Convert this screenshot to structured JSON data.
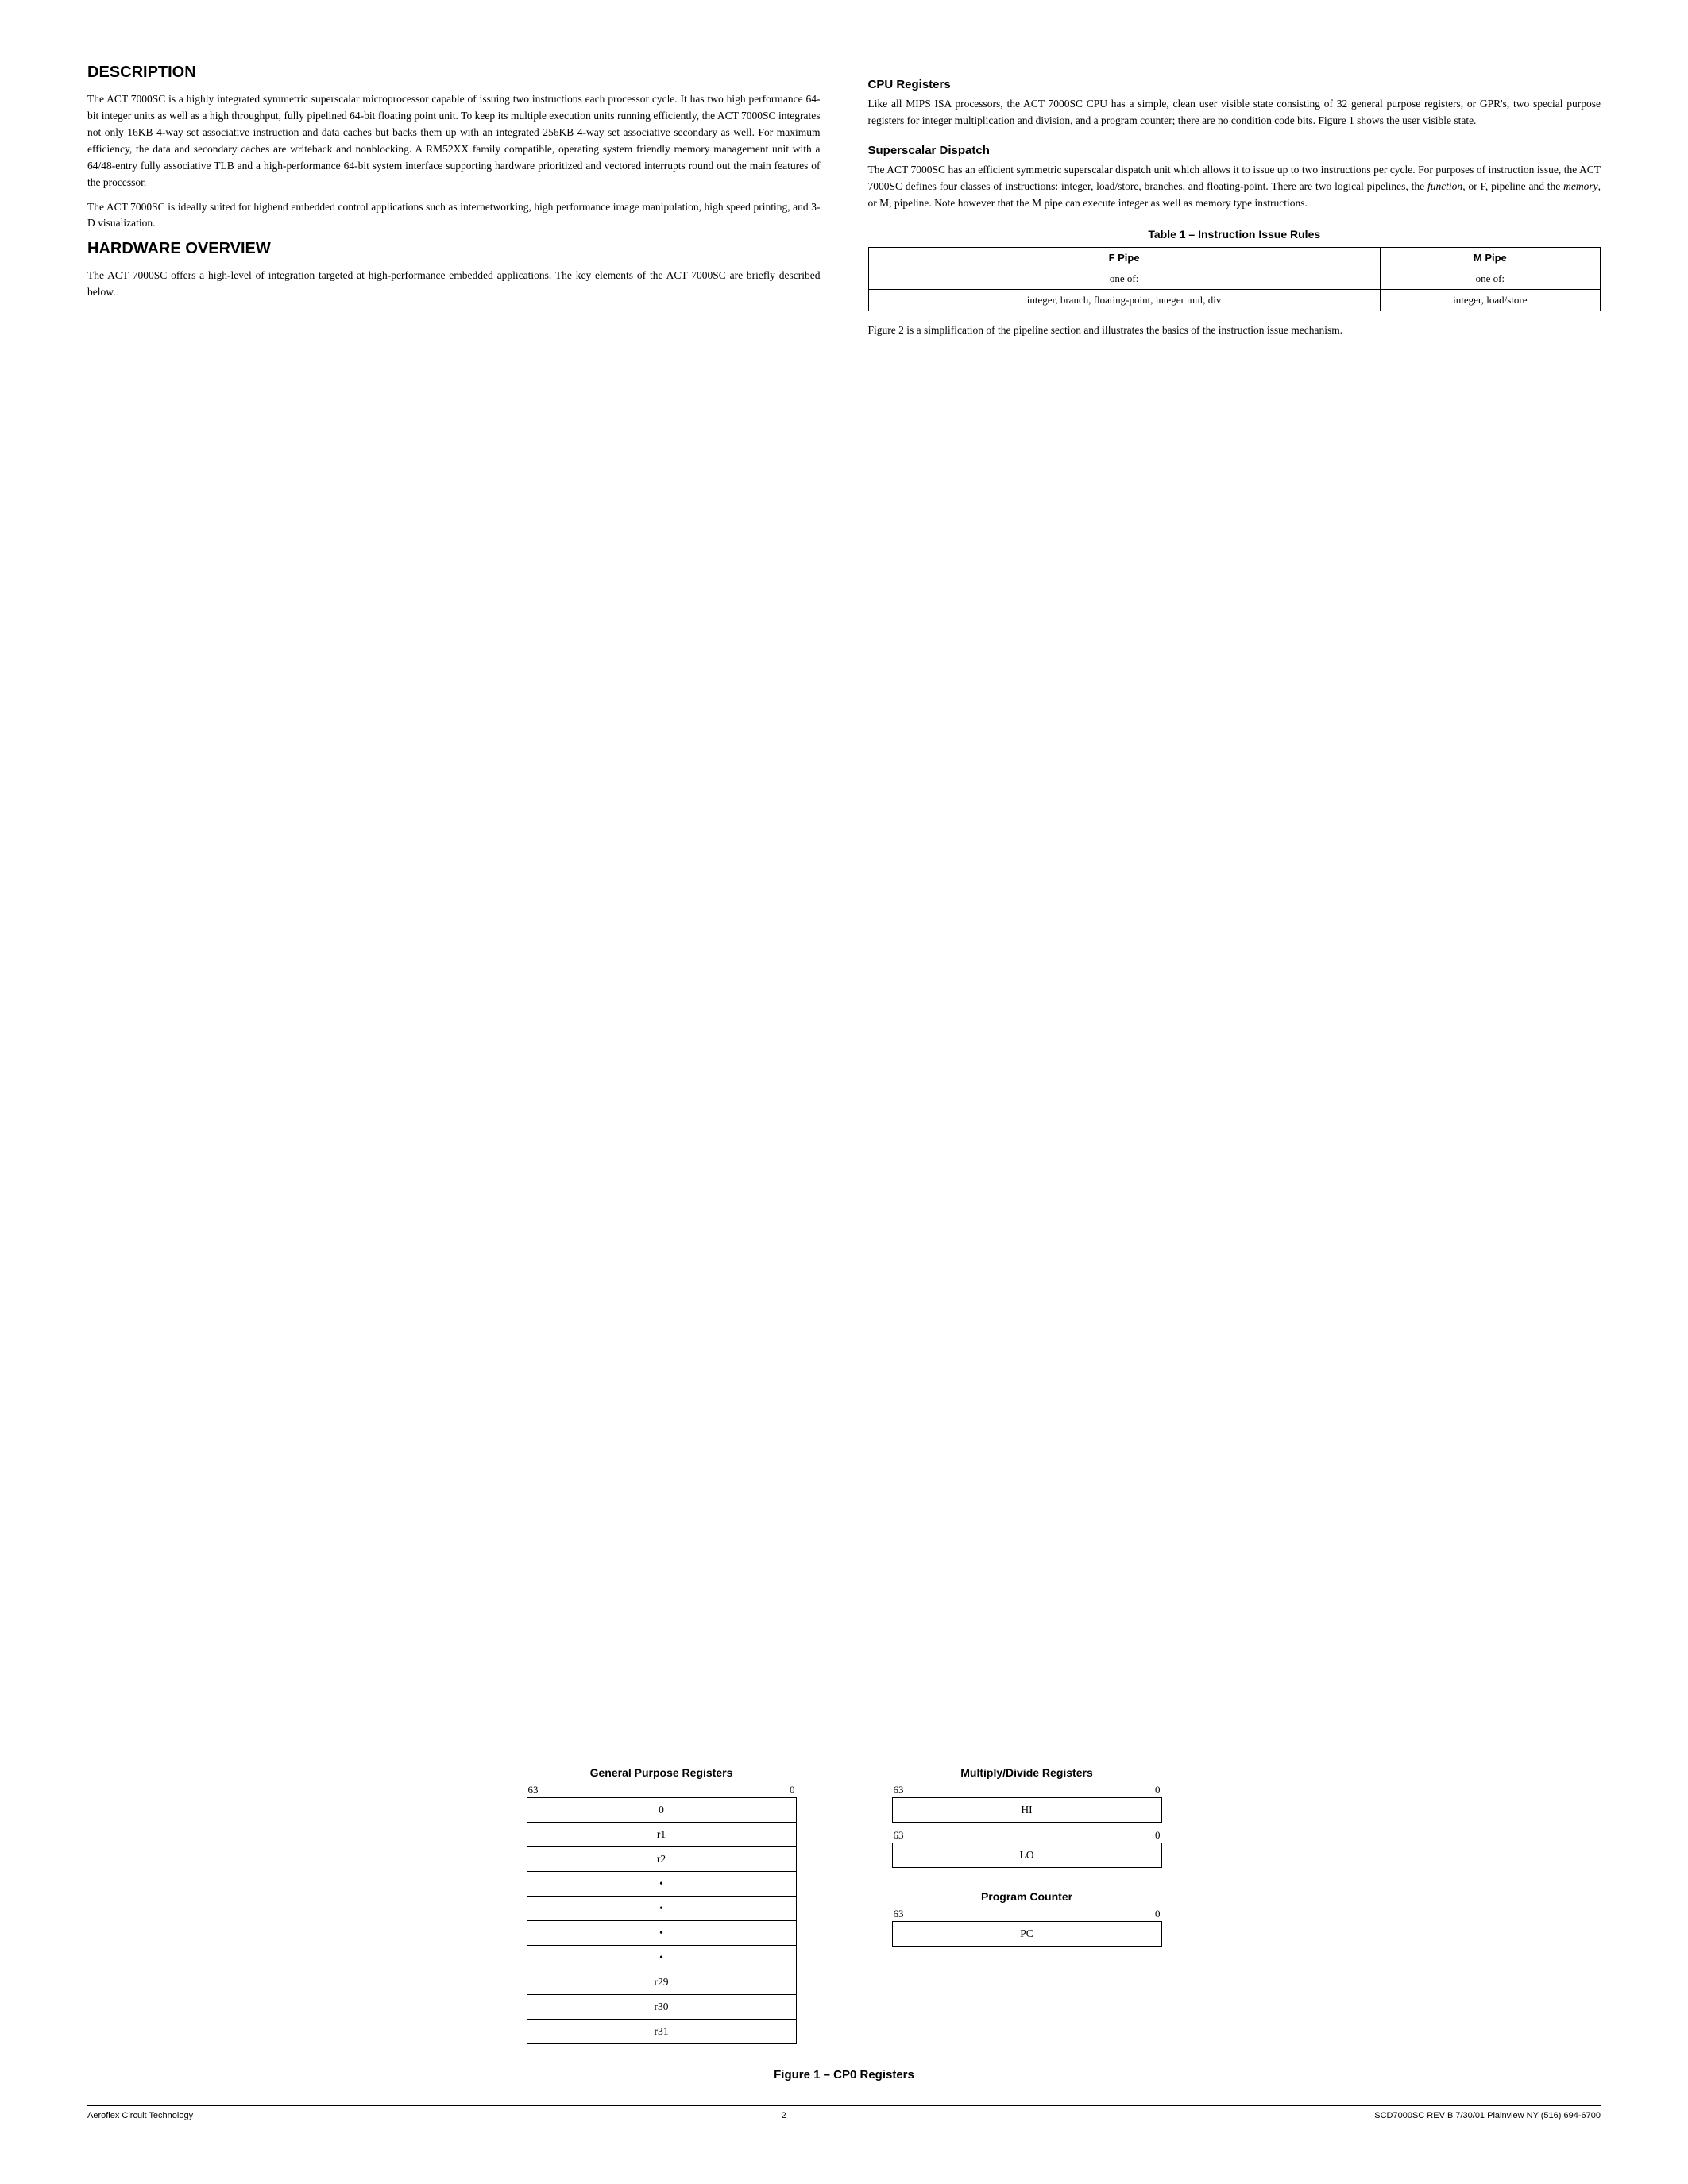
{
  "page": {
    "title": "CP0 Registers",
    "page_number": "2",
    "footer_left": "Aeroflex Circuit Technology",
    "footer_right": "SCD7000SC REV B  7/30/01  Plainview NY (516) 694-6700"
  },
  "description": {
    "section_title": "DESCRIPTION",
    "paragraph1": "The ACT 7000SC is a highly integrated symmetric superscalar microprocessor capable of issuing two instructions each processor cycle. It has two high performance 64-bit integer units as well as a high throughput, fully pipelined 64-bit floating point unit. To keep its multiple execution units running efficiently, the ACT 7000SC integrates not only 16KB 4-way set associative instruction and data caches but backs them up with an integrated 256KB 4-way set associative secondary as well. For maximum efficiency, the data and secondary caches are writeback and nonblocking. A RM52XX family compatible, operating system friendly memory management unit with a 64/48-entry fully associative TLB and a high-performance 64-bit system interface supporting hardware prioritized and vectored interrupts round out the main features of the processor.",
    "paragraph2": "The ACT 7000SC is ideally suited for highend embedded control applications such as internetworking, high performance image manipulation, high speed printing, and 3-D visualization."
  },
  "hardware_overview": {
    "section_title": "HARDWARE OVERVIEW",
    "paragraph1": "The ACT 7000SC offers a high-level of integration targeted at high-performance embedded applications. The key elements of the ACT 7000SC are briefly described below."
  },
  "cpu_registers": {
    "subsection_title": "CPU Registers",
    "paragraph1": "Like all MIPS ISA processors, the ACT 7000SC CPU has a simple, clean user visible state consisting of 32 general purpose registers, or GPR's, two special purpose registers for integer multiplication and division, and a program counter; there are no condition code bits. Figure 1 shows the user visible state."
  },
  "superscalar_dispatch": {
    "subsection_title": "Superscalar Dispatch",
    "paragraph1": "The ACT 7000SC has an efficient symmetric superscalar dispatch unit which allows it to issue up to two instructions per cycle. For purposes of instruction issue, the ACT 7000SC defines four classes of instructions: integer, load/store, branches, and floating-point. There are two logical pipelines, the function, or F, pipeline and the memory, or M, pipeline. Note however that the M pipe can execute integer as well as memory type instructions."
  },
  "table": {
    "title": "Table 1 – Instruction Issue Rules",
    "col1_header": "F Pipe",
    "col2_header": "M Pipe",
    "row1_col1": "one of:",
    "row1_col2": "one of:",
    "row2_col1": "integer, branch, floating-point, integer mul, div",
    "row2_col2": "integer, load/store"
  },
  "table_follow_text": "Figure 2 is a simplification of the pipeline section and illustrates the basics of the instruction issue mechanism.",
  "figures": {
    "gpr": {
      "title": "General Purpose Registers",
      "bit_high": "63",
      "bit_low": "0",
      "rows": [
        "0",
        "r1",
        "r2",
        "•",
        "•",
        "•",
        "•",
        "r29",
        "r30",
        "r31"
      ]
    },
    "mdr": {
      "title": "Multiply/Divide Registers",
      "bit_high": "63",
      "bit_low": "0",
      "hi_label": "HI",
      "lo_label": "LO",
      "hi_bit_high": "63",
      "hi_bit_low": "0",
      "lo_bit_high": "63",
      "lo_bit_low": "0"
    },
    "pc": {
      "title": "Program Counter",
      "bit_high": "63",
      "bit_low": "0",
      "pc_label": "PC"
    },
    "figure_caption": "Figure 1 – CP0 Registers"
  }
}
